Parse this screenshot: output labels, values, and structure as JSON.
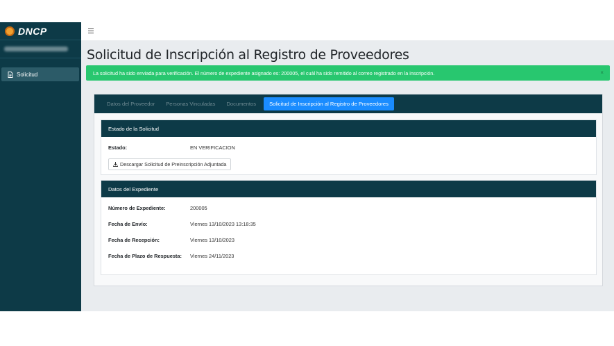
{
  "brand": {
    "name": "DNCP"
  },
  "sidebar": {
    "items": [
      {
        "label": "Solicitud",
        "icon": "document-icon"
      }
    ]
  },
  "page": {
    "title": "Solicitud de Inscripción al Registro de Proveedores"
  },
  "alert": {
    "message": "La solicitud ha sido enviada para verificación. El número de expediente asignado es: 200005, el cuál ha sido remitido al correo registrado en la inscripción.",
    "close": "×"
  },
  "tabs": [
    {
      "label": "Datos del Proveedor",
      "active": false
    },
    {
      "label": "Personas Vinculadas",
      "active": false
    },
    {
      "label": "Documentos",
      "active": false
    },
    {
      "label": "Solicitud de Inscripción al Registro de Proveedores",
      "active": true
    }
  ],
  "estado": {
    "header": "Estado de la Solicitud",
    "label": "Estado:",
    "value": "EN VERIFICACION",
    "download_label": "Descargar Solicitud de Preinscripción Adjuntada"
  },
  "expediente": {
    "header": "Datos del Expediente",
    "fields": [
      {
        "label": "Número de Expediente:",
        "value": "200005"
      },
      {
        "label": "Fecha de Envío:",
        "value": "Viernes 13/10/2023 13:18:35"
      },
      {
        "label": "Fecha de Recepción:",
        "value": "Viernes 13/10/2023"
      },
      {
        "label": "Fecha de Plazo de Respuesta:",
        "value": "Viernes 24/11/2023"
      }
    ]
  },
  "colors": {
    "sidebar": "#0d3a47",
    "alert": "#28c76f",
    "active_tab": "#1a8cff"
  }
}
